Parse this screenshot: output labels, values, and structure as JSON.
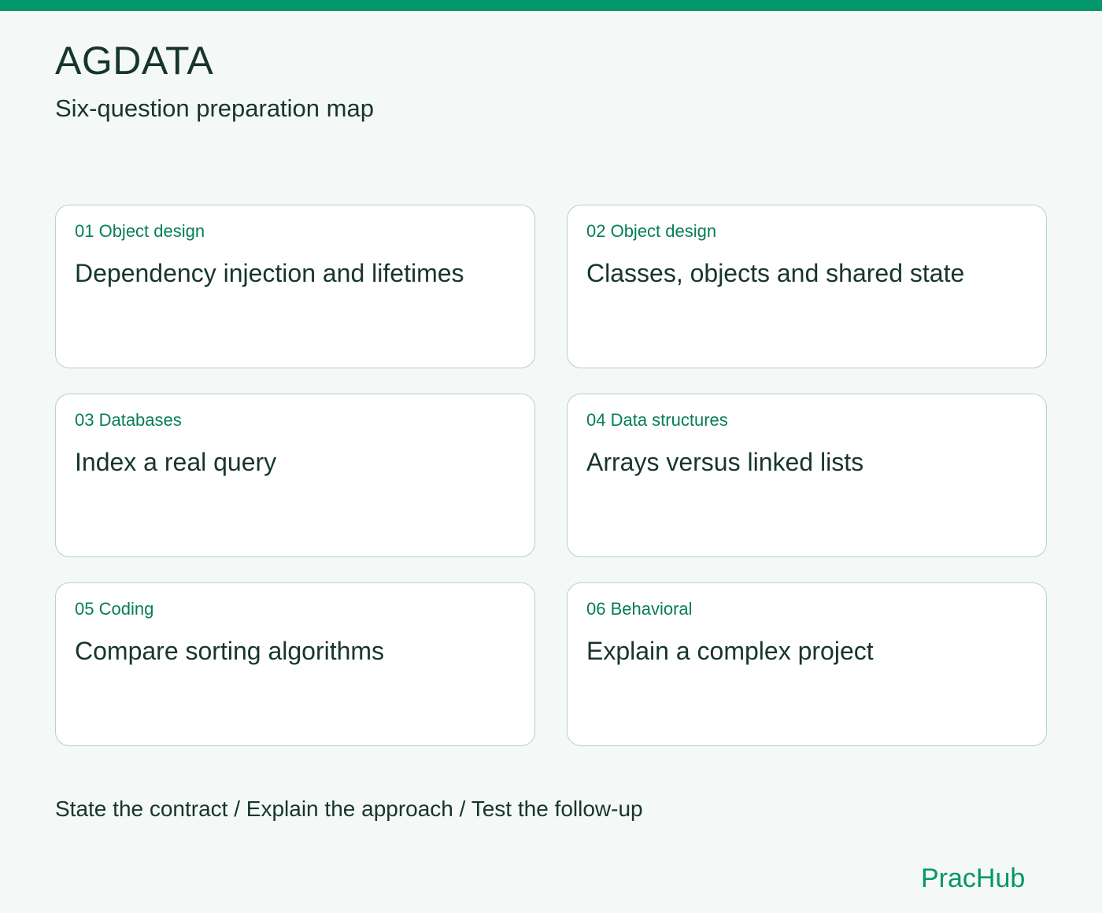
{
  "header": {
    "title": "AGDATA",
    "subtitle": "Six-question preparation map"
  },
  "cards": [
    {
      "tag": "01 Object design",
      "title": "Dependency injection and lifetimes"
    },
    {
      "tag": "02 Object design",
      "title": "Classes, objects and shared state"
    },
    {
      "tag": "03 Databases",
      "title": "Index a real query"
    },
    {
      "tag": "04 Data structures",
      "title": "Arrays versus linked lists"
    },
    {
      "tag": "05 Coding",
      "title": "Compare sorting algorithms"
    },
    {
      "tag": "06 Behavioral",
      "title": "Explain a complex project"
    }
  ],
  "footer": {
    "note": "State the contract / Explain the approach / Test the follow-up",
    "brand": "PracHub"
  },
  "colors": {
    "accent": "#03976b",
    "tag_text": "#067d5a",
    "text": "#17352d",
    "background": "#f4f8f6",
    "card_border": "#b3d4c9"
  }
}
